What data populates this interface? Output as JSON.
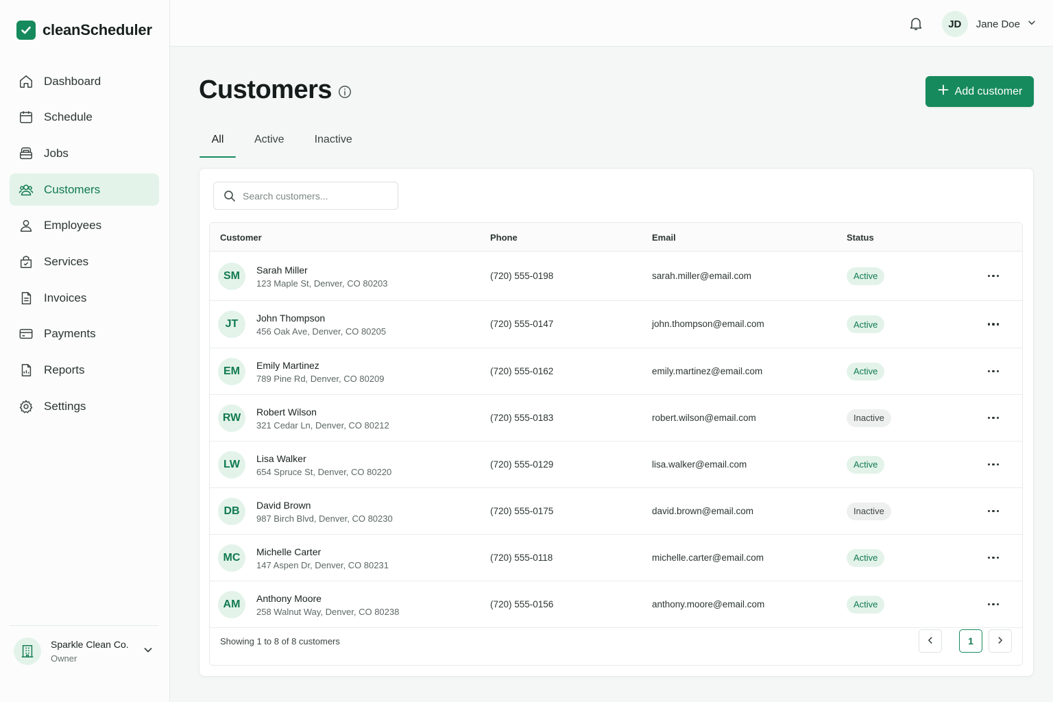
{
  "app": {
    "name": "cleanScheduler"
  },
  "sidebar": {
    "items": [
      {
        "label": "Dashboard",
        "icon": "home-icon"
      },
      {
        "label": "Schedule",
        "icon": "calendar-icon"
      },
      {
        "label": "Jobs",
        "icon": "jobs-icon"
      },
      {
        "label": "Customers",
        "icon": "users-icon",
        "active": true
      },
      {
        "label": "Employees",
        "icon": "user-icon"
      },
      {
        "label": "Services",
        "icon": "services-icon"
      },
      {
        "label": "Invoices",
        "icon": "invoice-icon"
      },
      {
        "label": "Payments",
        "icon": "card-icon"
      },
      {
        "label": "Reports",
        "icon": "report-icon"
      },
      {
        "label": "Settings",
        "icon": "gear-icon"
      }
    ],
    "org": {
      "name": "Sparkle Clean Co.",
      "role": "Owner"
    }
  },
  "header": {
    "user": {
      "initials": "JD",
      "name": "Jane Doe"
    }
  },
  "main": {
    "title": "Customers",
    "add_button": "Add customer",
    "tabs": [
      {
        "label": "All",
        "active": true
      },
      {
        "label": "Active"
      },
      {
        "label": "Inactive"
      }
    ],
    "search": {
      "placeholder": "Search customers..."
    },
    "columns": {
      "customer": "Customer",
      "phone": "Phone",
      "email": "Email",
      "status": "Status"
    },
    "rows": [
      {
        "initials": "SM",
        "name": "Sarah Miller",
        "address": "123 Maple St, Denver, CO 80203",
        "phone": "(720) 555-0198",
        "email": "sarah.miller@email.com",
        "status": "Active"
      },
      {
        "initials": "JT",
        "name": "John Thompson",
        "address": "456 Oak Ave, Denver, CO 80205",
        "phone": "(720) 555-0147",
        "email": "john.thompson@email.com",
        "status": "Active"
      },
      {
        "initials": "EM",
        "name": "Emily Martinez",
        "address": "789 Pine Rd, Denver, CO 80209",
        "phone": "(720) 555-0162",
        "email": "emily.martinez@email.com",
        "status": "Active"
      },
      {
        "initials": "RW",
        "name": "Robert Wilson",
        "address": "321 Cedar Ln, Denver, CO 80212",
        "phone": "(720) 555-0183",
        "email": "robert.wilson@email.com",
        "status": "Inactive"
      },
      {
        "initials": "LW",
        "name": "Lisa Walker",
        "address": "654 Spruce St, Denver, CO 80220",
        "phone": "(720) 555-0129",
        "email": "lisa.walker@email.com",
        "status": "Active"
      },
      {
        "initials": "DB",
        "name": "David Brown",
        "address": "987 Birch Blvd, Denver, CO 80230",
        "phone": "(720) 555-0175",
        "email": "david.brown@email.com",
        "status": "Inactive"
      },
      {
        "initials": "MC",
        "name": "Michelle Carter",
        "address": "147 Aspen Dr, Denver, CO 80231",
        "phone": "(720) 555-0118",
        "email": "michelle.carter@email.com",
        "status": "Active"
      },
      {
        "initials": "AM",
        "name": "Anthony Moore",
        "address": "258 Walnut Way, Denver, CO 80238",
        "phone": "(720) 555-0156",
        "email": "anthony.moore@email.com",
        "status": "Active"
      }
    ],
    "footer": {
      "showing": "Showing 1 to 8 of 8 customers",
      "current_page": "1"
    }
  },
  "colors": {
    "accent": "#168a5c",
    "accent_light": "#e3f3ea",
    "background": "#f4f7f5"
  }
}
